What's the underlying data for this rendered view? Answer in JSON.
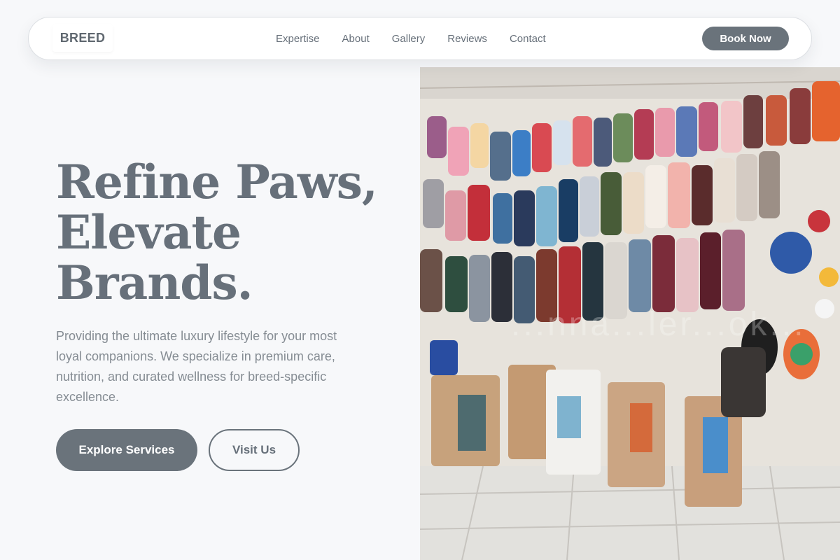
{
  "nav": {
    "logo": "BREED",
    "links": [
      "Expertise",
      "About",
      "Gallery",
      "Reviews",
      "Contact"
    ],
    "cta": "Book Now"
  },
  "hero": {
    "title_lines": [
      "Refine Paws,",
      "Elevate",
      "Brands."
    ],
    "description": "Providing the ultimate luxury lifestyle for your most loyal companions. We specialize in premium care, nutrition, and curated wellness for breed-specific excellence.",
    "primary_cta": "Explore Services",
    "secondary_cta": "Visit Us"
  },
  "image": {
    "subject": "Pet store shelves with hanging pet clothes, toys and bags of cat food",
    "watermark": "...nna...ler...ok..."
  },
  "colors": {
    "background": "#f7f8fa",
    "accent": "#6a737b",
    "text": "#67707a",
    "muted_text": "#858c93"
  }
}
